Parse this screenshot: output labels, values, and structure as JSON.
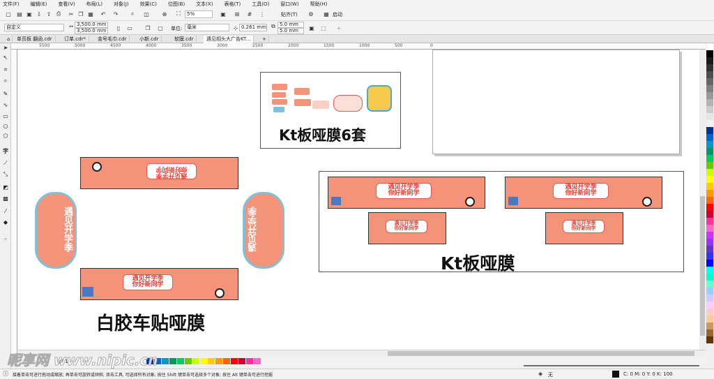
{
  "menu": [
    "文件(F)",
    "编辑(E)",
    "查看(V)",
    "布局(L)",
    "对象(J)",
    "效果(C)",
    "位图(B)",
    "文本(X)",
    "表格(T)",
    "工具(O)",
    "窗口(W)",
    "帮助(H)"
  ],
  "toolbar": {
    "zoom": "5%",
    "snap_label": "贴齐(T)",
    "launch_label": "启动"
  },
  "property_bar": {
    "page_size": "自定义",
    "width": "3,500.0 mm",
    "height": "3,500.0 mm",
    "unit_label": "单位:",
    "unit_value": "毫米",
    "nudge": "0.261 mm",
    "dup_x": "5.0 mm",
    "dup_y": "5.0 mm"
  },
  "tabs": [
    "单页板 翻函.cdr",
    "订单.cdr*",
    "金号毛巾.cdr",
    "小新.cdr",
    "软膜.cdr",
    "遇见相头大广告KT..."
  ],
  "ruler_labels": [
    "5500",
    "5000",
    "4500",
    "4000",
    "3500",
    "3000",
    "2500",
    "2000",
    "1500",
    "1000",
    "500",
    "0"
  ],
  "artwork": {
    "banner_text_1": "遇见开学季",
    "banner_text_2": "你好新同学",
    "label_kt6": "Kt板哑膜6套",
    "label_kt": "Kt板哑膜",
    "label_car": "白胶车贴哑膜"
  },
  "page_nav": {
    "page_label": "页 1"
  },
  "status": {
    "hint": "接着单击可进行拖动或缩放; 再单击可旋转或倾斜; 双击工具, 可选择所有对象; 按住 Shift 键单击可选择多个对象; 按住 Alt 键单击可进行挖掘",
    "fill_none": "无",
    "color_readout": "C: 0 M: 0 Y: 0 K: 100"
  },
  "watermark": {
    "site": "昵享网 www.nipic.cn",
    "id": "ID:22385547 NO:20260509115535178105"
  },
  "palette_colors": [
    "#ffffff",
    "#000000",
    "#1a1a1a",
    "#333333",
    "#4d4d4d",
    "#666666",
    "#808080",
    "#999999",
    "#b3b3b3",
    "#cccccc",
    "#e6e6e6",
    "#f2f2f2",
    "#003399",
    "#0066cc",
    "#0099cc",
    "#009966",
    "#00cc66",
    "#66cc00",
    "#ccff00",
    "#ffff00",
    "#ffcc00",
    "#ff9900",
    "#ff6600",
    "#ff0000",
    "#cc0033",
    "#ff3399",
    "#ff66cc",
    "#cc33ff",
    "#9933ff",
    "#6633cc",
    "#3333ff",
    "#0000ff",
    "#00ffff",
    "#00ffcc",
    "#66ffcc",
    "#99ccff",
    "#ccccff",
    "#ffccff",
    "#ffcccc",
    "#ffcc99",
    "#cc9966",
    "#996633",
    "#663300"
  ]
}
